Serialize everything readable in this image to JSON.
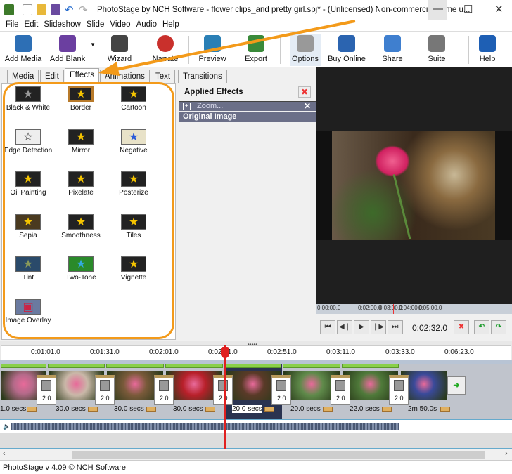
{
  "window": {
    "title": "PhotoStage by NCH Software - flower clips_and pretty girl.spj* - (Unlicensed) Non-commercial home u...",
    "minimize": "—",
    "maximize": "☐",
    "close": "✕"
  },
  "menu": [
    "File",
    "Edit",
    "Slideshow",
    "Slide",
    "Video",
    "Audio",
    "Help"
  ],
  "toolbar": [
    {
      "label": "Add Media",
      "icon": "add-media-icon",
      "color": "#2d6fb5"
    },
    {
      "label": "Add Blank",
      "icon": "add-blank-icon",
      "color": "#6b3fa0"
    },
    {
      "label": "Wizard",
      "icon": "wizard-icon",
      "color": "#444"
    },
    {
      "label": "Narrate",
      "icon": "record-icon",
      "color": "#c9302c"
    },
    {
      "label": "Preview",
      "icon": "preview-icon",
      "color": "#2a7fb5"
    },
    {
      "label": "Export",
      "icon": "export-icon",
      "color": "#3a8a3a"
    },
    {
      "label": "Options",
      "icon": "options-icon",
      "color": "#999"
    },
    {
      "label": "Buy Online",
      "icon": "buy-online-icon",
      "color": "#2b64b0"
    },
    {
      "label": "Share",
      "icon": "share-icon",
      "color": "#3f7fcf"
    },
    {
      "label": "Suite",
      "icon": "suite-icon",
      "color": "#777"
    },
    {
      "label": "Help",
      "icon": "help-icon",
      "color": "#1e5fb4"
    }
  ],
  "tabs": [
    "Media",
    "Edit",
    "Effects",
    "Animations",
    "Text",
    "Transitions"
  ],
  "active_tab": "Effects",
  "effects": [
    "Black & White",
    "Border",
    "Cartoon",
    "Edge Detection",
    "Mirror",
    "Negative",
    "Oil Painting",
    "Pixelate",
    "Posterize",
    "Sepia",
    "Smoothness",
    "Tiles",
    "Tint",
    "Two-Tone",
    "Vignette",
    "Image Overlay"
  ],
  "applied": {
    "title": "Applied Effects",
    "items": [
      "Zoom..."
    ],
    "base": "Original Image"
  },
  "preview": {
    "ruler": [
      "0:00:00.0",
      "0:02:00.0",
      "0:03:00.0",
      "0:04:00.0",
      "0:05:00.0"
    ],
    "time": "0:02:32.0"
  },
  "timeline": {
    "ruler": [
      "0:01:01.0",
      "0:01:31.0",
      "0:02:01.0",
      "0:02:21.0",
      "0:02:51.0",
      "0:03:11.0",
      "0:03:33.0",
      "0:06:23.0"
    ],
    "clips": [
      {
        "dur": "1.0 secs",
        "color": "#b56a8a"
      },
      {
        "dur": "30.0 secs",
        "color": "#c9b8a8"
      },
      {
        "dur": "30.0 secs",
        "color": "#7a5a3a"
      },
      {
        "dur": "30.0 secs",
        "color": "#b8202a"
      },
      {
        "dur": "20.0 secs",
        "color": "#5a3a28"
      },
      {
        "dur": "20.0 secs",
        "color": "#5f8a4a"
      },
      {
        "dur": "22.0 secs",
        "color": "#4f7a3a"
      },
      {
        "dur": "2m 50.0s",
        "color": "#3a4a9a"
      }
    ],
    "transitions": [
      "2.0",
      "2.0",
      "2.0",
      "2.0",
      "2.0",
      "2.0",
      "2.0"
    ],
    "selected_clip": 4
  },
  "status": "PhotoStage v 4.09 © NCH Software",
  "accent": "#f39a1a"
}
